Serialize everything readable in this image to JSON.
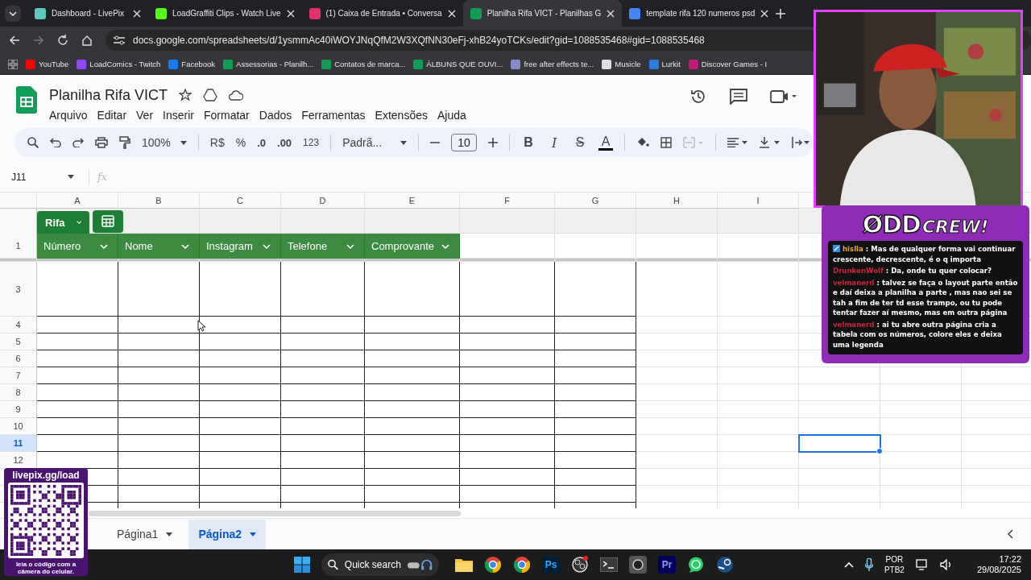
{
  "browser": {
    "tabs": [
      {
        "title": "Dashboard - LivePix",
        "selected": false
      },
      {
        "title": "LoadGraffiti Clips - Watch Live",
        "selected": false
      },
      {
        "title": "(1) Caixa de Entrada • Conversa",
        "selected": false
      },
      {
        "title": "Planilha Rifa VICT - Planilhas G",
        "selected": true
      },
      {
        "title": "template rifa 120 numeros psd",
        "selected": false
      }
    ],
    "address": "docs.google.com/spreadsheets/d/1ysmmAc40iWOYJNqQfM2W3XQfNN30eFj-xhB24yoTCKs/edit?gid=1088535468#gid=1088535468",
    "bookmarks": [
      "YouTube",
      "LoadComics - Twitch",
      "Facebook",
      "Assessorias - Planilh...",
      "Contatos de marca...",
      "ÁLBUNS QUE OUVI...",
      "free after effects te...",
      "Musicle",
      "Lurkit",
      "Discover Games - I"
    ]
  },
  "sheets": {
    "title": "Planilha Rifa VICT",
    "menu": [
      "Arquivo",
      "Editar",
      "Ver",
      "Inserir",
      "Formatar",
      "Dados",
      "Ferramentas",
      "Extensões",
      "Ajuda"
    ],
    "toolbar": {
      "zoom": "100%",
      "currency": "R$",
      "percent": "%",
      "decrease_decimals": ".0",
      "increase_decimals": ".00",
      "number_format": "123",
      "font": "Padrã...",
      "font_size": "10",
      "bold": "B",
      "italic": "I",
      "strikethrough": "S",
      "text_color": "A"
    },
    "name_box": "J11",
    "formula_label": "fx",
    "columns": [
      "A",
      "B",
      "C",
      "D",
      "E",
      "F",
      "G",
      "H",
      "I"
    ],
    "table": {
      "name": "Rifa",
      "headers": [
        "Número",
        "Nome",
        "Instagram",
        "Telefone",
        "Comprovante"
      ]
    },
    "rows": [
      {
        "label": "1",
        "selected": false
      },
      {
        "label": "3",
        "selected": false
      },
      {
        "label": "4",
        "selected": false
      },
      {
        "label": "5",
        "selected": false
      },
      {
        "label": "6",
        "selected": false
      },
      {
        "label": "7",
        "selected": false
      },
      {
        "label": "8",
        "selected": false
      },
      {
        "label": "9",
        "selected": false
      },
      {
        "label": "10",
        "selected": false
      },
      {
        "label": "11",
        "selected": true
      },
      {
        "label": "12",
        "selected": false
      }
    ],
    "sheet_tabs": [
      {
        "label": "Página1",
        "selected": false
      },
      {
        "label": "Página2",
        "selected": true
      }
    ]
  },
  "overlays": {
    "chat": {
      "logo": "ØDD",
      "logo_tail": "CREW!",
      "messages": [
        {
          "user": "hislla",
          "color": "#e9a23b",
          "badge": true,
          "text": ": Mas de qualquer forma vai continuar crescente, decrescente, é o q importa"
        },
        {
          "user": "DrunkenWolf",
          "color": "#c8243c",
          "badge": false,
          "text": ": Da, onde tu quer colocar?"
        },
        {
          "user": "velmanerd",
          "color": "#c8243c",
          "badge": false,
          "text": ": talvez se faça o layout parte então e daí deixa a planilha a parte , mas nao sei se tah a fim de ter td esse trampo, ou tu pode tentar fazer aí mesmo, mas em outra página"
        },
        {
          "user": "velmanerd",
          "color": "#c8243c",
          "badge": false,
          "text": ": ai tu abre outra página cria a tabela com os números, colore eles e deixa uma legenda"
        }
      ]
    },
    "qr": {
      "url": "livepix.gg/load",
      "caption": "leia o código com a câmera do celular."
    }
  },
  "taskbar": {
    "search": "Quick search",
    "apps": [
      {
        "kind": "folder"
      },
      {
        "kind": "chrome"
      },
      {
        "kind": "chrome"
      },
      {
        "kind": "text",
        "label": "Ps"
      },
      {
        "kind": "obs"
      },
      {
        "kind": "terminal"
      },
      {
        "kind": "camera"
      },
      {
        "kind": "text",
        "label": "Pr"
      },
      {
        "kind": "whatsapp"
      },
      {
        "kind": "steam"
      }
    ],
    "language": "POR",
    "layout": "PTB2",
    "time": "17:22",
    "date": "29/08/2025"
  }
}
